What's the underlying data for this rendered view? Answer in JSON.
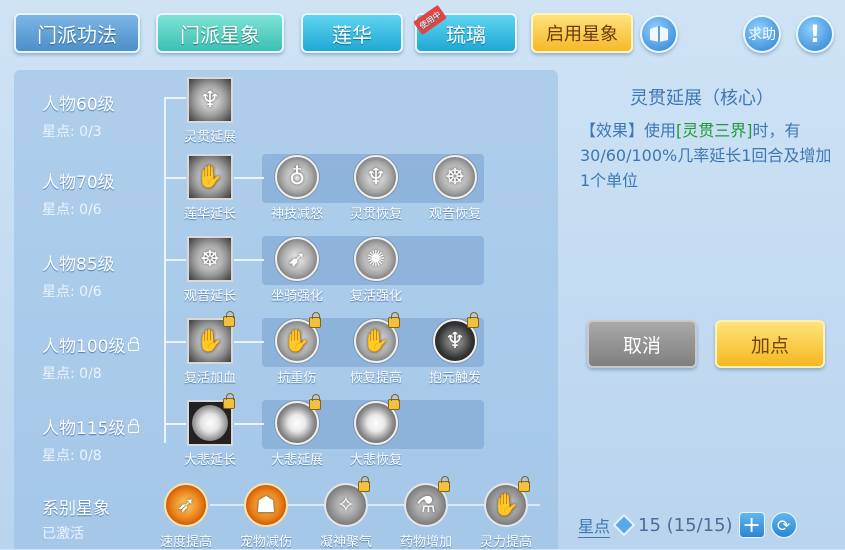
{
  "tabs": {
    "sect_skill": "门派功法",
    "sect_star": "门派星象",
    "lotus": "莲华",
    "glass": "琉璃",
    "glass_badge": "使用中",
    "activate": "启用星象",
    "help": "求助",
    "alert": "!"
  },
  "rows": [
    {
      "level": "人物60级",
      "points": "星点: 0/3",
      "locked": false
    },
    {
      "level": "人物70级",
      "points": "星点: 0/6",
      "locked": false
    },
    {
      "level": "人物85级",
      "points": "星点: 0/6",
      "locked": false
    },
    {
      "level": "人物100级",
      "points": "星点: 0/8",
      "locked": true
    },
    {
      "level": "人物115级",
      "points": "星点: 0/8",
      "locked": true
    }
  ],
  "series": {
    "label": "系别星象",
    "status": "已激活"
  },
  "nodes": {
    "r1": [
      "灵贯延展"
    ],
    "r2": [
      "莲华延长",
      "神技减怒",
      "灵贯恢复",
      "观音恢复"
    ],
    "r3": [
      "观音延长",
      "坐骑强化",
      "复活强化"
    ],
    "r4": [
      "复活加血",
      "抗重伤",
      "恢复提高",
      "抱元触发"
    ],
    "r5": [
      "大悲延长",
      "大悲延展",
      "大悲恢复"
    ],
    "series": [
      "速度提高",
      "宠物减伤",
      "凝神聚气",
      "药物增加",
      "灵力提高"
    ]
  },
  "detail": {
    "title": "灵贯延展（核心）",
    "effect_tag": "【效果】",
    "text_a": "使用",
    "skill": "[灵贯三界]",
    "text_b": "时，有30/60/100%几率延长1回合及增加1个单位"
  },
  "buttons": {
    "cancel": "取消",
    "add": "加点"
  },
  "stars": {
    "label": "星点",
    "value": "15 (15/15)",
    "plus": "+"
  },
  "colors": {
    "accent": "#3d78b5",
    "highlight": "#1f9a3b"
  }
}
